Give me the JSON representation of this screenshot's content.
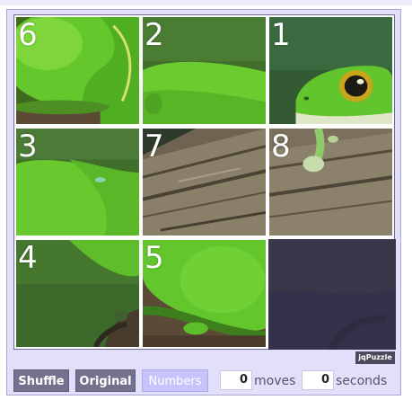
{
  "puzzle": {
    "tiles": [
      {
        "number": "6",
        "name": "tile-6"
      },
      {
        "number": "2",
        "name": "tile-2"
      },
      {
        "number": "1",
        "name": "tile-1"
      },
      {
        "number": "3",
        "name": "tile-3"
      },
      {
        "number": "7",
        "name": "tile-7"
      },
      {
        "number": "8",
        "name": "tile-8"
      },
      {
        "number": "4",
        "name": "tile-4"
      },
      {
        "number": "5",
        "name": "tile-5"
      }
    ],
    "brand": "jqPuzzle"
  },
  "controls": {
    "shuffle_label": "Shuffle",
    "original_label": "Original",
    "numbers_label": "Numbers",
    "moves_value": "0",
    "moves_label": "moves",
    "seconds_value": "0",
    "seconds_label": "seconds"
  },
  "colors": {
    "frame_bg": "#e1dff9",
    "button_dark": "#73718d",
    "button_light": "#c7c4fb",
    "frog_green": "#5fc32a"
  }
}
